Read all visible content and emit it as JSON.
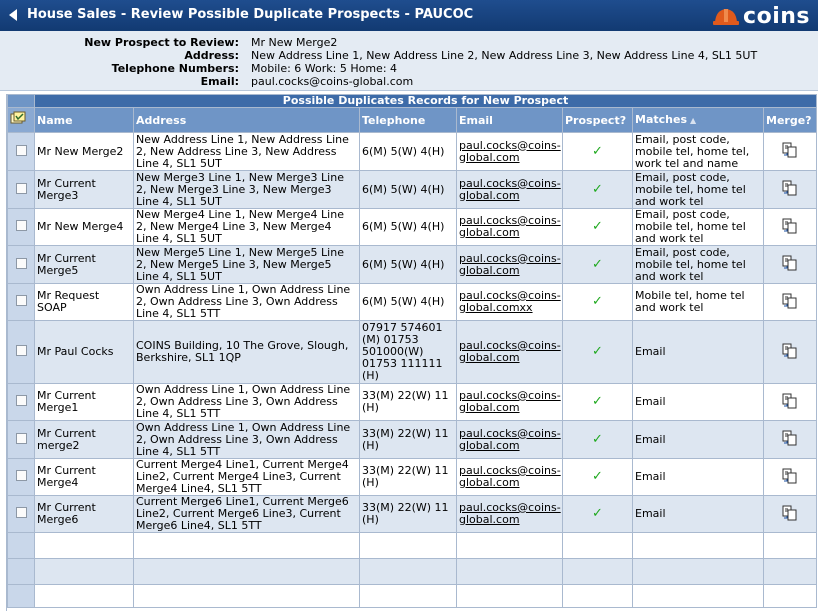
{
  "window": {
    "title": "House Sales - Review Possible Duplicate Prospects - PAUCOC",
    "logo_text": "coins",
    "logo_color": "#e05a1c"
  },
  "prospect": {
    "name_label": "New Prospect to Review:",
    "name_value": "Mr New Merge2",
    "address_label": "Address:",
    "address_value": "New Address Line 1, New Address Line 2, New Address Line 3, New Address Line 4, SL1 5UT",
    "phone_label": "Telephone Numbers:",
    "phone_value": "Mobile: 6 Work: 5 Home: 4",
    "email_label": "Email:",
    "email_value": "paul.cocks@coins-global.com"
  },
  "grid": {
    "caption": "Possible Duplicates Records for New Prospect",
    "columns": {
      "name": "Name",
      "address": "Address",
      "telephone": "Telephone",
      "email": "Email",
      "prospect": "Prospect?",
      "matches": "Matches",
      "merge": "Merge?"
    },
    "rows": [
      {
        "name": "Mr New Merge2",
        "address": "New Address Line 1, New Address Line 2, New Address Line 3, New Address Line 4, SL1 5UT",
        "telephone": "6(M) 5(W) 4(H)",
        "email": "paul.cocks@coins-global.com",
        "prospect": "✓",
        "matches": "Email, post code, mobile tel, home tel, work tel and name"
      },
      {
        "name": "Mr Current Merge3",
        "address": "New Merge3 Line 1, New Merge3 Line 2, New Merge3 Line 3, New Merge3 Line 4, SL1 5UT",
        "telephone": "6(M) 5(W) 4(H)",
        "email": "paul.cocks@coins-global.com",
        "prospect": "✓",
        "matches": "Email, post code, mobile tel, home tel and work tel"
      },
      {
        "name": "Mr New Merge4",
        "address": "New Merge4 Line 1, New Merge4 Line 2, New Merge4 Line 3, New Merge4 Line 4, SL1 5UT",
        "telephone": "6(M) 5(W) 4(H)",
        "email": "paul.cocks@coins-global.com",
        "prospect": "✓",
        "matches": "Email, post code, mobile tel, home tel and work tel"
      },
      {
        "name": "Mr Current Merge5",
        "address": "New Merge5 Line 1, New Merge5 Line 2, New Merge5 Line 3, New Merge5 Line 4, SL1 5UT",
        "telephone": "6(M) 5(W) 4(H)",
        "email": "paul.cocks@coins-global.com",
        "prospect": "✓",
        "matches": "Email, post code, mobile tel, home tel and work tel"
      },
      {
        "name": "Mr Request SOAP",
        "address": "Own Address Line 1, Own Address Line 2, Own Address Line 3, Own Address Line 4, SL1 5TT",
        "telephone": "6(M) 5(W) 4(H)",
        "email": "paul.cocks@coins-global.comxx",
        "prospect": "✓",
        "matches": "Mobile tel, home tel and work tel"
      },
      {
        "name": "Mr Paul Cocks",
        "address": "COINS Building, 10 The Grove, Slough, Berkshire, SL1 1QP",
        "telephone": "07917 574601 (M) 01753 501000(W) 01753 111111 (H)",
        "email": "paul.cocks@coins-global.com",
        "prospect": "✓",
        "matches": "Email"
      },
      {
        "name": "Mr Current Merge1",
        "address": "Own Address Line 1, Own Address Line 2, Own Address Line 3, Own Address Line 4, SL1 5TT",
        "telephone": "33(M) 22(W) 11 (H)",
        "email": "paul.cocks@coins-global.com",
        "prospect": "✓",
        "matches": "Email"
      },
      {
        "name": "Mr Current merge2",
        "address": "Own Address Line 1, Own Address Line 2, Own Address Line 3, Own Address Line 4, SL1 5TT",
        "telephone": "33(M) 22(W) 11 (H)",
        "email": "paul.cocks@coins-global.com",
        "prospect": "✓",
        "matches": "Email"
      },
      {
        "name": "Mr Current Merge4",
        "address": "Current Merge4 Line1, Current Merge4 Line2, Current Merge4 Line3, Current Merge4 Line4, SL1 5TT",
        "telephone": "33(M) 22(W) 11 (H)",
        "email": "paul.cocks@coins-global.com",
        "prospect": "✓",
        "matches": "Email"
      },
      {
        "name": "Mr Current Merge6",
        "address": "Current Merge6 Line1, Current Merge6 Line2, Current Merge6 Line3, Current Merge6 Line4, SL1 5TT",
        "telephone": "33(M) 22(W) 11 (H)",
        "email": "paul.cocks@coins-global.com",
        "prospect": "✓",
        "matches": "Email"
      }
    ]
  }
}
